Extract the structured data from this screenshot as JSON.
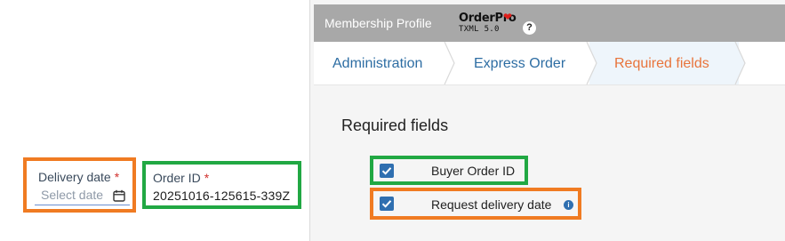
{
  "delivery_date": {
    "label": "Delivery date",
    "required_mark": "*",
    "placeholder": "Select date"
  },
  "order_id": {
    "label": "Order ID",
    "required_mark": "*",
    "value": "20251016-125615-339Z"
  },
  "app": {
    "title": "Membership Profile",
    "logo_name": "OrderPro",
    "logo_version": "TXML 5.0",
    "help_glyph": "?"
  },
  "breadcrumb": [
    {
      "label": "Administration"
    },
    {
      "label": "Express Order"
    },
    {
      "label": "Required fields"
    }
  ],
  "required_fields": {
    "title": "Required fields",
    "items": [
      {
        "label": "Buyer Order ID",
        "checked": true
      },
      {
        "label": "Request delivery date",
        "checked": true,
        "info_glyph": "i"
      }
    ]
  },
  "colors": {
    "highlight_orange": "#f07b22",
    "highlight_green": "#21a843",
    "link_blue": "#2d6da3",
    "active_orange": "#e8743b",
    "checkbox_blue": "#2f6fb0"
  },
  "icons": [
    "calendar-icon",
    "heart-icon",
    "help-icon",
    "checkbox-checked-icon",
    "info-icon"
  ]
}
